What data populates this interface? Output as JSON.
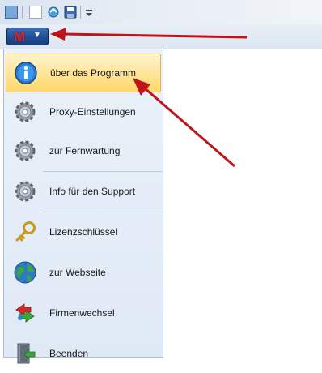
{
  "app": {
    "logo_letter": "M",
    "caret": "▼"
  },
  "qat": {
    "icons": [
      "window-icon",
      "document-icon",
      "refresh-icon",
      "save-icon",
      "qat-menu-icon"
    ]
  },
  "menu": {
    "items": [
      {
        "label": "über das Programm",
        "icon": "info-icon"
      },
      {
        "label": "Proxy-Einstellungen",
        "icon": "gear-icon"
      },
      {
        "label": "zur Fernwartung",
        "icon": "gear-icon"
      },
      {
        "label": "Info für den Support",
        "icon": "gear-icon"
      },
      {
        "label": "Lizenzschlüssel",
        "icon": "key-icon"
      },
      {
        "label": "zur Webseite",
        "icon": "globe-icon"
      },
      {
        "label": "Firmenwechsel",
        "icon": "switch-icon"
      },
      {
        "label": "Beenden",
        "icon": "exit-icon"
      }
    ]
  },
  "colors": {
    "accent_red": "#c0141a",
    "hover_bg": "#ffe59b",
    "menu_bg": "#e4ecf7"
  }
}
